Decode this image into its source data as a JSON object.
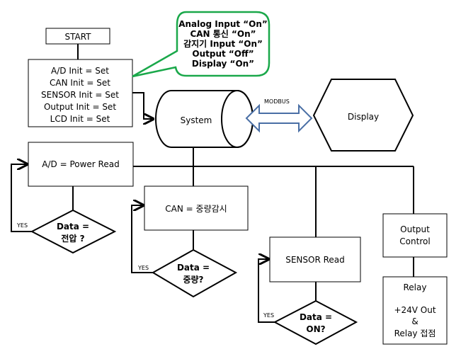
{
  "start": "START",
  "init": [
    "A/D Init = Set",
    "CAN Init = Set",
    "SENSOR Init = Set",
    "Output Init = Set",
    "LCD Init = Set"
  ],
  "callout": [
    "Analog Input “On”",
    "CAN 통신 “On”",
    "감지기 Input “On”",
    "Output “Off”",
    "Display “On”"
  ],
  "system": "System",
  "modbus": "MODBUS",
  "display": "Display",
  "ad_read": "A/D = Power Read",
  "can_read": "CAN = 중량감시",
  "sensor_read": "SENSOR Read",
  "output_control": [
    "Output",
    "Control"
  ],
  "relay": [
    "Relay",
    "+24V Out",
    "&",
    "Relay 접점"
  ],
  "decision1": [
    "Data =",
    "전압 ?"
  ],
  "decision2": [
    "Data =",
    "중량?"
  ],
  "decision3": [
    "Data =",
    "ON?"
  ],
  "yes": "YES",
  "colors": {
    "callout_border": "#1aa84a",
    "modbus_arrow": "#4a6fa5"
  }
}
